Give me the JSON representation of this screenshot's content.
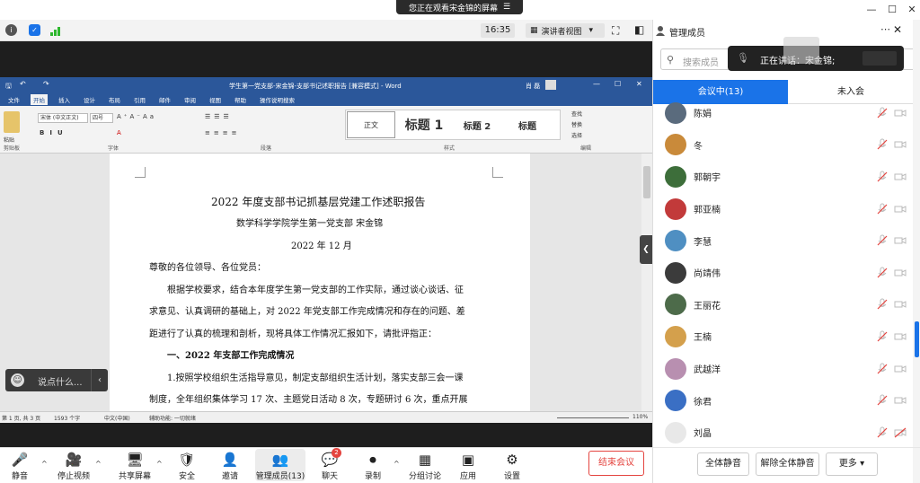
{
  "banner": {
    "text": "您正在观看宋金锦的屏幕"
  },
  "toolbar": {
    "timer": "16:35",
    "view_label": "演讲者视图"
  },
  "word": {
    "title": "学生第一党支部-宋金锦-支部书记述职报告 [兼容模式] - Word",
    "user": "肖 磊",
    "tabs": [
      "文件",
      "开始",
      "插入",
      "设计",
      "布局",
      "引用",
      "邮件",
      "审阅",
      "视图",
      "帮助",
      "操作说明搜索"
    ],
    "active_tab": "开始",
    "font_name": "宋体 (中文正文)",
    "font_size": "四号",
    "styles": [
      "正文",
      "标题 1",
      "标题 2",
      "标题"
    ],
    "editing": [
      "查找",
      "替换",
      "选择"
    ],
    "groups": [
      "剪贴板",
      "字体",
      "段落",
      "样式",
      "编辑"
    ],
    "status": {
      "page": "第 1 页, 共 3 页",
      "words": "1593 个字",
      "lang": "中文(中国)",
      "accessibility": "辅助功能: 一切就绪",
      "zoom": "110%"
    },
    "doc": {
      "title": "2022 年度支部书记抓基层党建工作述职报告",
      "subtitle": "数学科学学院学生第一党支部    宋金锦",
      "date": "2022 年 12 月",
      "greeting": "尊敬的各位领导、各位党员：",
      "para1_l1": "根据学校要求，结合本年度学生第一党支部的工作实际，通过谈心谈话、征",
      "para1_l2": "求意见、认真调研的基础上，对 2022 年党支部工作完成情况和存在的问题、差",
      "para1_l3": "距进行了认真的梳理和剖析，现将具体工作情况汇报如下，请批评指正：",
      "heading1": "一、2022 年支部工作完成情况",
      "para2_l1": "1.按照学校组织生活指导意见，制定支部组织生活计划，落实支部三会一课",
      "para2_l2": "制度，全年组织集体学习  17 次、主题党日活动 8 次，专题研讨 6 次，重点开展"
    }
  },
  "chat": {
    "placeholder": "说点什么..."
  },
  "bottom": {
    "buttons": [
      "静音",
      "停止视频",
      "共享屏幕",
      "安全",
      "邀请",
      "管理成员(13)",
      "聊天",
      "录制",
      "分组讨论",
      "应用",
      "设置"
    ],
    "chat_badge": "2",
    "end": "结束会议"
  },
  "panel": {
    "title": "管理成员",
    "search_placeholder": "搜索成员",
    "speaking": "正在讲话：宋金锦;",
    "tab_in": "会议中(13)",
    "tab_not": "未入会",
    "members": [
      {
        "name": "陈娟",
        "color": "#5a6b7d"
      },
      {
        "name": "冬",
        "color": "#c98a3a"
      },
      {
        "name": "郭朝宇",
        "color": "#3d6e3a"
      },
      {
        "name": "郭亚楠",
        "color": "#c23a3a"
      },
      {
        "name": "李慧",
        "color": "#4f8fc2"
      },
      {
        "name": "尚靖伟",
        "color": "#3b3b3b"
      },
      {
        "name": "王丽花",
        "color": "#4d6b4a"
      },
      {
        "name": "王楠",
        "color": "#d4a04c"
      },
      {
        "name": "武越洋",
        "color": "#b88fb0"
      },
      {
        "name": "徐君",
        "color": "#3a6fc4"
      },
      {
        "name": "刘晶",
        "color": "#e8e8e8"
      }
    ],
    "mute_all": "全体静音",
    "unmute_all": "解除全体静音",
    "more": "更多"
  },
  "colors": {
    "accent": "#1a73e8",
    "word_blue": "#2b579a",
    "end_red": "#e4443f"
  }
}
